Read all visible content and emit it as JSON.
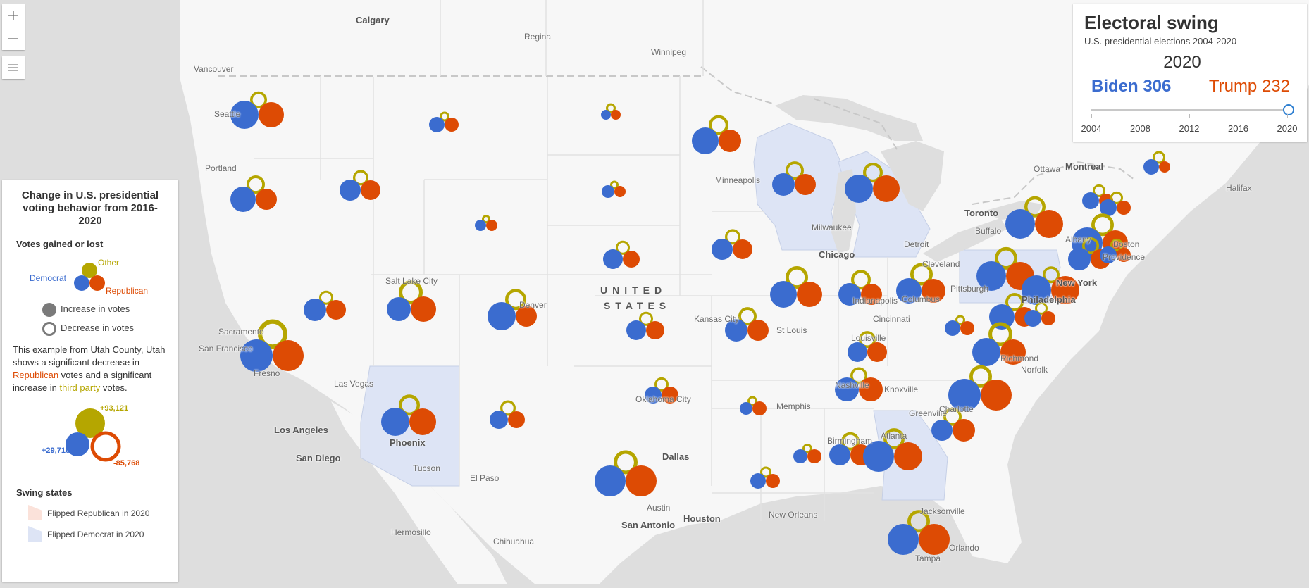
{
  "map": {
    "country_label_line1": "UNITED",
    "country_label_line2": "STATES",
    "city_labels": [
      {
        "name": "Calgary",
        "major": true
      },
      {
        "name": "Regina"
      },
      {
        "name": "Winnipeg"
      },
      {
        "name": "Vancouver"
      },
      {
        "name": "Seattle"
      },
      {
        "name": "Portland"
      },
      {
        "name": "Minneapolis"
      },
      {
        "name": "Milwaukee"
      },
      {
        "name": "Chicago",
        "major": true
      },
      {
        "name": "Detroit"
      },
      {
        "name": "Toronto",
        "major": true
      },
      {
        "name": "Buffalo"
      },
      {
        "name": "Ottawa"
      },
      {
        "name": "Montreal",
        "major": true
      },
      {
        "name": "Halifax"
      },
      {
        "name": "Albany"
      },
      {
        "name": "Boston"
      },
      {
        "name": "Providence"
      },
      {
        "name": "New York",
        "major": true
      },
      {
        "name": "Philadelphia",
        "major": true
      },
      {
        "name": "Pittsburgh"
      },
      {
        "name": "Cleveland"
      },
      {
        "name": "Columbus"
      },
      {
        "name": "Indianapolis"
      },
      {
        "name": "Cincinnati"
      },
      {
        "name": "Louisville"
      },
      {
        "name": "St Louis"
      },
      {
        "name": "Kansas City"
      },
      {
        "name": "Salt Lake City"
      },
      {
        "name": "Denver"
      },
      {
        "name": "Sacramento"
      },
      {
        "name": "San Francisco"
      },
      {
        "name": "Fresno"
      },
      {
        "name": "Las Vegas"
      },
      {
        "name": "Los Angeles",
        "major": true
      },
      {
        "name": "San Diego",
        "major": true
      },
      {
        "name": "Phoenix",
        "major": true
      },
      {
        "name": "Tucson"
      },
      {
        "name": "El Paso"
      },
      {
        "name": "Hermosillo"
      },
      {
        "name": "Chihuahua"
      },
      {
        "name": "Oklahoma City"
      },
      {
        "name": "Dallas",
        "major": true
      },
      {
        "name": "Austin"
      },
      {
        "name": "San Antonio",
        "major": true
      },
      {
        "name": "Houston",
        "major": true
      },
      {
        "name": "Memphis"
      },
      {
        "name": "Nashville"
      },
      {
        "name": "Knoxville"
      },
      {
        "name": "Birmingham"
      },
      {
        "name": "Atlanta"
      },
      {
        "name": "New Orleans"
      },
      {
        "name": "Greenville"
      },
      {
        "name": "Charlotte"
      },
      {
        "name": "Richmond"
      },
      {
        "name": "Norfolk"
      },
      {
        "name": "Jacksonville"
      },
      {
        "name": "Orlando"
      },
      {
        "name": "Tampa"
      }
    ],
    "zoom_in_icon": "plus-icon",
    "zoom_out_icon": "minus-icon",
    "layer_list_icon": "list-icon"
  },
  "colors": {
    "democrat": "#3b6ccf",
    "republican": "#dd4b04",
    "other": "#b5a600",
    "flipped_republican": "#fbe2da",
    "flipped_democrat": "#dde4f5",
    "slider_accent": "#2e7fd1"
  },
  "legend": {
    "title": "Change in U.S. presidential voting behavior from 2016-2020",
    "votes_heading": "Votes gained or lost",
    "other_label": "Other",
    "democrat_label": "Democrat",
    "republican_label": "Republican",
    "increase_label": "Increase in votes",
    "decrease_label": "Decrease in votes",
    "example_text_1": "This example from Utah County, Utah shows a significant decrease in ",
    "example_republican": "Republican",
    "example_text_2": " votes and a significant increase in ",
    "example_third": "third party",
    "example_text_3": " votes.",
    "example_other_value": "+93,121",
    "example_dem_value": "+29,716",
    "example_rep_value": "-85,768",
    "swing_heading": "Swing states",
    "flipped_rep_label": "Flipped Republican in 2020",
    "flipped_dem_label": "Flipped Democrat in 2020"
  },
  "panel": {
    "title": "Electoral swing",
    "subtitle": "U.S. presidential elections 2004-2020",
    "selected_year": "2020",
    "dem_candidate": "Biden 306",
    "rep_candidate": "Trump 232",
    "slider_years": [
      "2004",
      "2008",
      "2012",
      "2016",
      "2020"
    ],
    "slider_value": "2020"
  }
}
